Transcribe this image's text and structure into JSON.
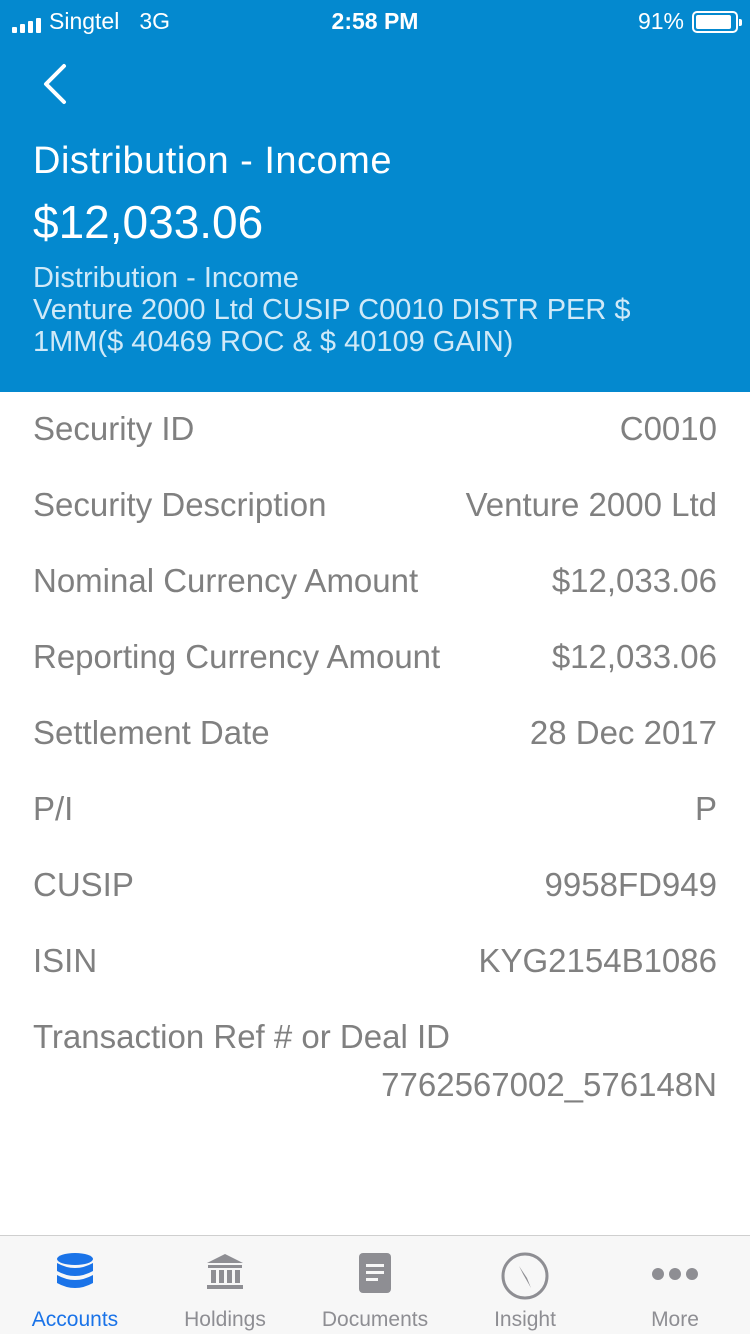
{
  "status_bar": {
    "carrier": "Singtel",
    "network": "3G",
    "time": "2:58 PM",
    "battery": "91%",
    "battery_level": 0.91
  },
  "header": {
    "title": "Distribution - Income",
    "amount": "$12,033.06",
    "desc_line1": "Distribution - Income",
    "desc_line2": "Venture 2000 Ltd CUSIP C0010 DISTR PER $ 1MM($ 40469 ROC & $ 40109 GAIN)"
  },
  "details": [
    {
      "label": "Security ID",
      "value": "C0010"
    },
    {
      "label": "Security Description",
      "value": "Venture 2000 Ltd"
    },
    {
      "label": "Nominal Currency Amount",
      "value": "$12,033.06"
    },
    {
      "label": "Reporting Currency Amount",
      "value": "$12,033.06"
    },
    {
      "label": "Settlement Date",
      "value": "28 Dec 2017"
    },
    {
      "label": "P/I",
      "value": "P"
    },
    {
      "label": "CUSIP",
      "value": "9958FD949"
    },
    {
      "label": "ISIN",
      "value": "KYG2154B1086"
    },
    {
      "label": "Transaction Ref # or Deal ID",
      "value": "7762567002_576148N"
    }
  ],
  "tabs": [
    {
      "label": "Accounts",
      "icon": "database-icon",
      "active": true
    },
    {
      "label": "Holdings",
      "icon": "bank-icon",
      "active": false
    },
    {
      "label": "Documents",
      "icon": "document-icon",
      "active": false
    },
    {
      "label": "Insight",
      "icon": "compass-icon",
      "active": false
    },
    {
      "label": "More",
      "icon": "more-dots-icon",
      "active": false
    }
  ],
  "colors": {
    "header_bg": "#0489cf",
    "active_tab": "#1a73e8",
    "inactive_tab": "#8e8e93",
    "detail_text": "#808080"
  }
}
